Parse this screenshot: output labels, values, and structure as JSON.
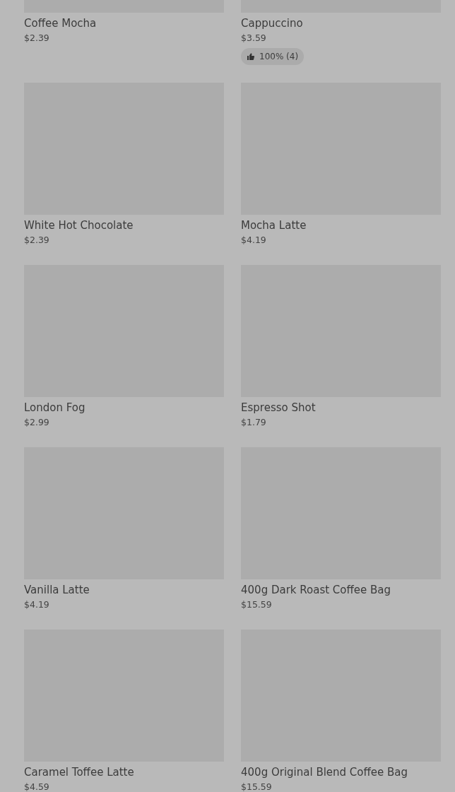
{
  "products": [
    {
      "name": "Coffee Mocha",
      "price": "$2.39"
    },
    {
      "name": "Cappuccino",
      "price": "$3.59",
      "rating": {
        "text": "100% (4)"
      }
    },
    {
      "name": "White Hot Chocolate",
      "price": "$2.39"
    },
    {
      "name": "Mocha Latte",
      "price": "$4.19"
    },
    {
      "name": "London Fog",
      "price": "$2.99"
    },
    {
      "name": "Espresso Shot",
      "price": "$1.79"
    },
    {
      "name": "Vanilla Latte",
      "price": "$4.19"
    },
    {
      "name": "400g Dark Roast Coffee Bag",
      "price": "$15.59"
    },
    {
      "name": "Caramel Toffee Latte",
      "price": "$4.59"
    },
    {
      "name": "400g Original Blend Coffee Bag",
      "price": "$15.59"
    }
  ]
}
